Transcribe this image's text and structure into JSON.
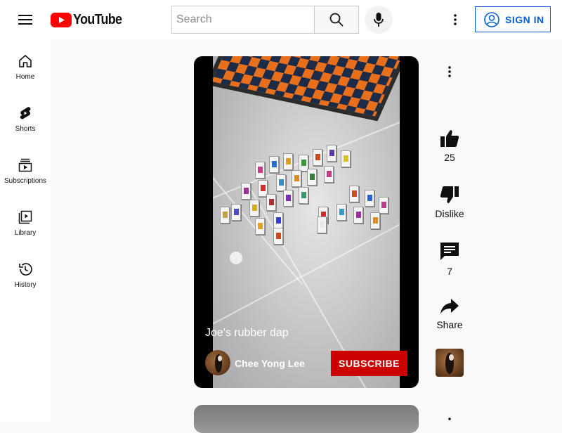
{
  "header": {
    "logo_text": "YouTube",
    "search_placeholder": "Search",
    "signin_label": "SIGN IN"
  },
  "sidebar": {
    "items": [
      {
        "label": "Home",
        "icon": "home-icon"
      },
      {
        "label": "Shorts",
        "icon": "shorts-icon"
      },
      {
        "label": "Subscriptions",
        "icon": "subscriptions-icon"
      },
      {
        "label": "Library",
        "icon": "library-icon"
      },
      {
        "label": "History",
        "icon": "history-icon"
      }
    ]
  },
  "video": {
    "title": "Joe's rubber dap",
    "channel_name": "Chee Yong Lee",
    "subscribe_label": "SUBSCRIBE"
  },
  "actions": {
    "like_count": "25",
    "dislike_label": "Dislike",
    "comment_count": "7",
    "share_label": "Share"
  },
  "colors": {
    "brand_red": "#ff0000",
    "subscribe_red": "#cc0000",
    "signin_blue": "#065fd4"
  }
}
